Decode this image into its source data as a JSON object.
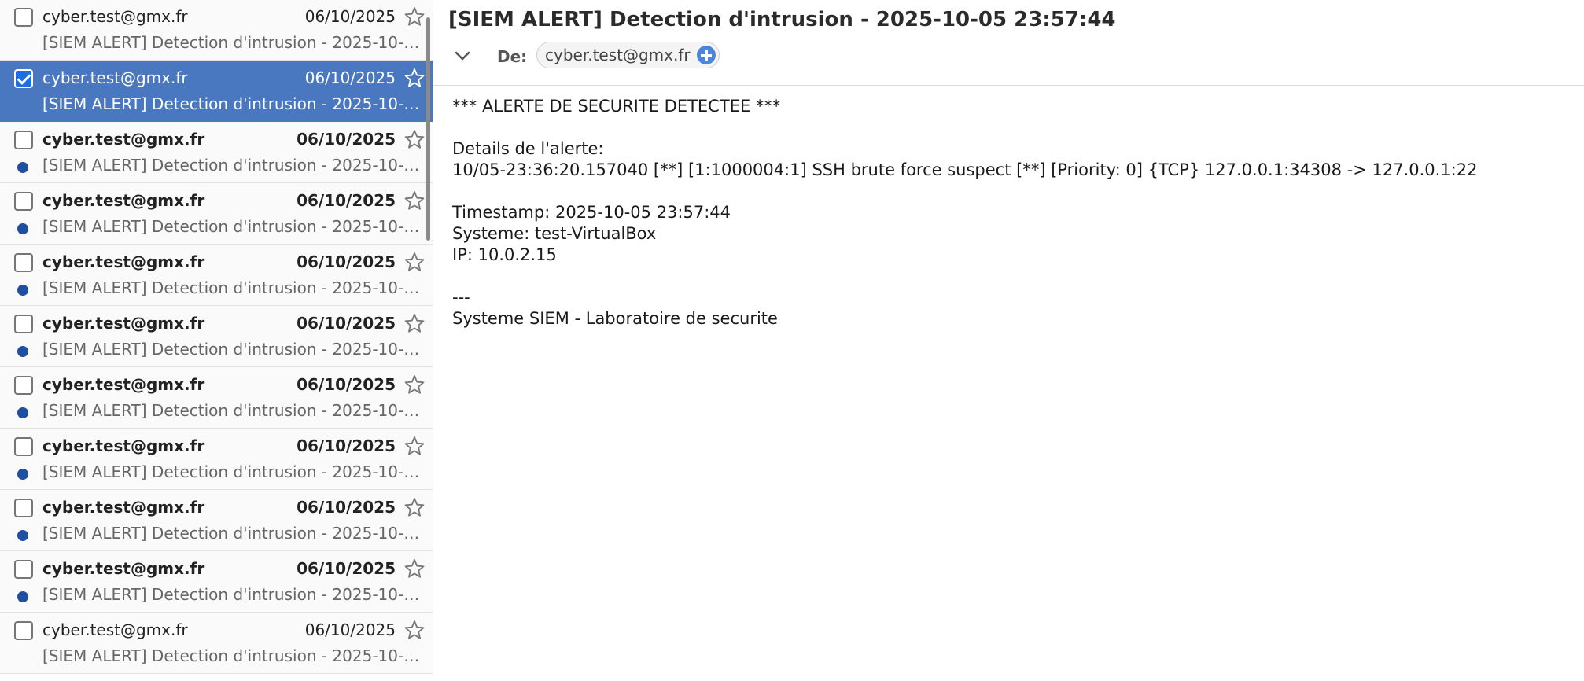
{
  "message_list": {
    "rows": [
      {
        "sender": "cyber.test@gmx.fr",
        "date": "06/10/2025",
        "subject": "[SIEM ALERT] Detection d'intrusion - 2025-10-05 23:57:44",
        "unread": false,
        "checked": false,
        "selected": false
      },
      {
        "sender": "cyber.test@gmx.fr",
        "date": "06/10/2025",
        "subject": "[SIEM ALERT] Detection d'intrusion - 2025-10-05 23:57:44",
        "unread": false,
        "checked": true,
        "selected": true
      },
      {
        "sender": "cyber.test@gmx.fr",
        "date": "06/10/2025",
        "subject": "[SIEM ALERT] Detection d'intrusion - 2025-10-05 23:57:44",
        "unread": true,
        "checked": false,
        "selected": false
      },
      {
        "sender": "cyber.test@gmx.fr",
        "date": "06/10/2025",
        "subject": "[SIEM ALERT] Detection d'intrusion - 2025-10-05 23:57:44",
        "unread": true,
        "checked": false,
        "selected": false
      },
      {
        "sender": "cyber.test@gmx.fr",
        "date": "06/10/2025",
        "subject": "[SIEM ALERT] Detection d'intrusion - 2025-10-05 23:57:44",
        "unread": true,
        "checked": false,
        "selected": false
      },
      {
        "sender": "cyber.test@gmx.fr",
        "date": "06/10/2025",
        "subject": "[SIEM ALERT] Detection d'intrusion - 2025-10-05 23:57:44",
        "unread": true,
        "checked": false,
        "selected": false
      },
      {
        "sender": "cyber.test@gmx.fr",
        "date": "06/10/2025",
        "subject": "[SIEM ALERT] Detection d'intrusion - 2025-10-05 23:57:44",
        "unread": true,
        "checked": false,
        "selected": false
      },
      {
        "sender": "cyber.test@gmx.fr",
        "date": "06/10/2025",
        "subject": "[SIEM ALERT] Detection d'intrusion - 2025-10-05 23:57:44",
        "unread": true,
        "checked": false,
        "selected": false
      },
      {
        "sender": "cyber.test@gmx.fr",
        "date": "06/10/2025",
        "subject": "[SIEM ALERT] Detection d'intrusion - 2025-10-05 23:57:44",
        "unread": true,
        "checked": false,
        "selected": false
      },
      {
        "sender": "cyber.test@gmx.fr",
        "date": "06/10/2025",
        "subject": "[SIEM ALERT] Detection d'intrusion - 2025-10-05 23:57:44",
        "unread": true,
        "checked": false,
        "selected": false
      },
      {
        "sender": "cyber.test@gmx.fr",
        "date": "06/10/2025",
        "subject": "[SIEM ALERT] Detection d'intrusion - 2025-10-05 23:57:44",
        "unread": false,
        "checked": false,
        "selected": false
      }
    ]
  },
  "reading_pane": {
    "subject": "[SIEM ALERT] Detection d'intrusion - 2025-10-05 23:57:44",
    "from_label": "De:",
    "from_address": "cyber.test@gmx.fr",
    "body_lines": [
      "*** ALERTE DE SECURITE DETECTEE ***",
      "",
      "Details de l'alerte:",
      "10/05-23:36:20.157040 [**] [1:1000004:1] SSH brute force suspect [**] [Priority: 0] {TCP} 127.0.0.1:34308 -> 127.0.0.1:22",
      "",
      "Timestamp: 2025-10-05 23:57:44",
      "Systeme: test-VirtualBox",
      "IP: 10.0.2.15",
      "",
      "---",
      "Systeme SIEM - Laboratoire de securite"
    ]
  },
  "icons": {
    "star": "star-outline-icon",
    "collapse": "chevron-down-icon",
    "add_contact": "plus-circle-icon",
    "unread_marker": "unread-dot-icon"
  },
  "colors": {
    "selected_row": "#4a78c0",
    "unread_dot": "#1f4ea3",
    "checkbox_checked": "#1b6ee6",
    "add_contact": "#4d86d9"
  }
}
